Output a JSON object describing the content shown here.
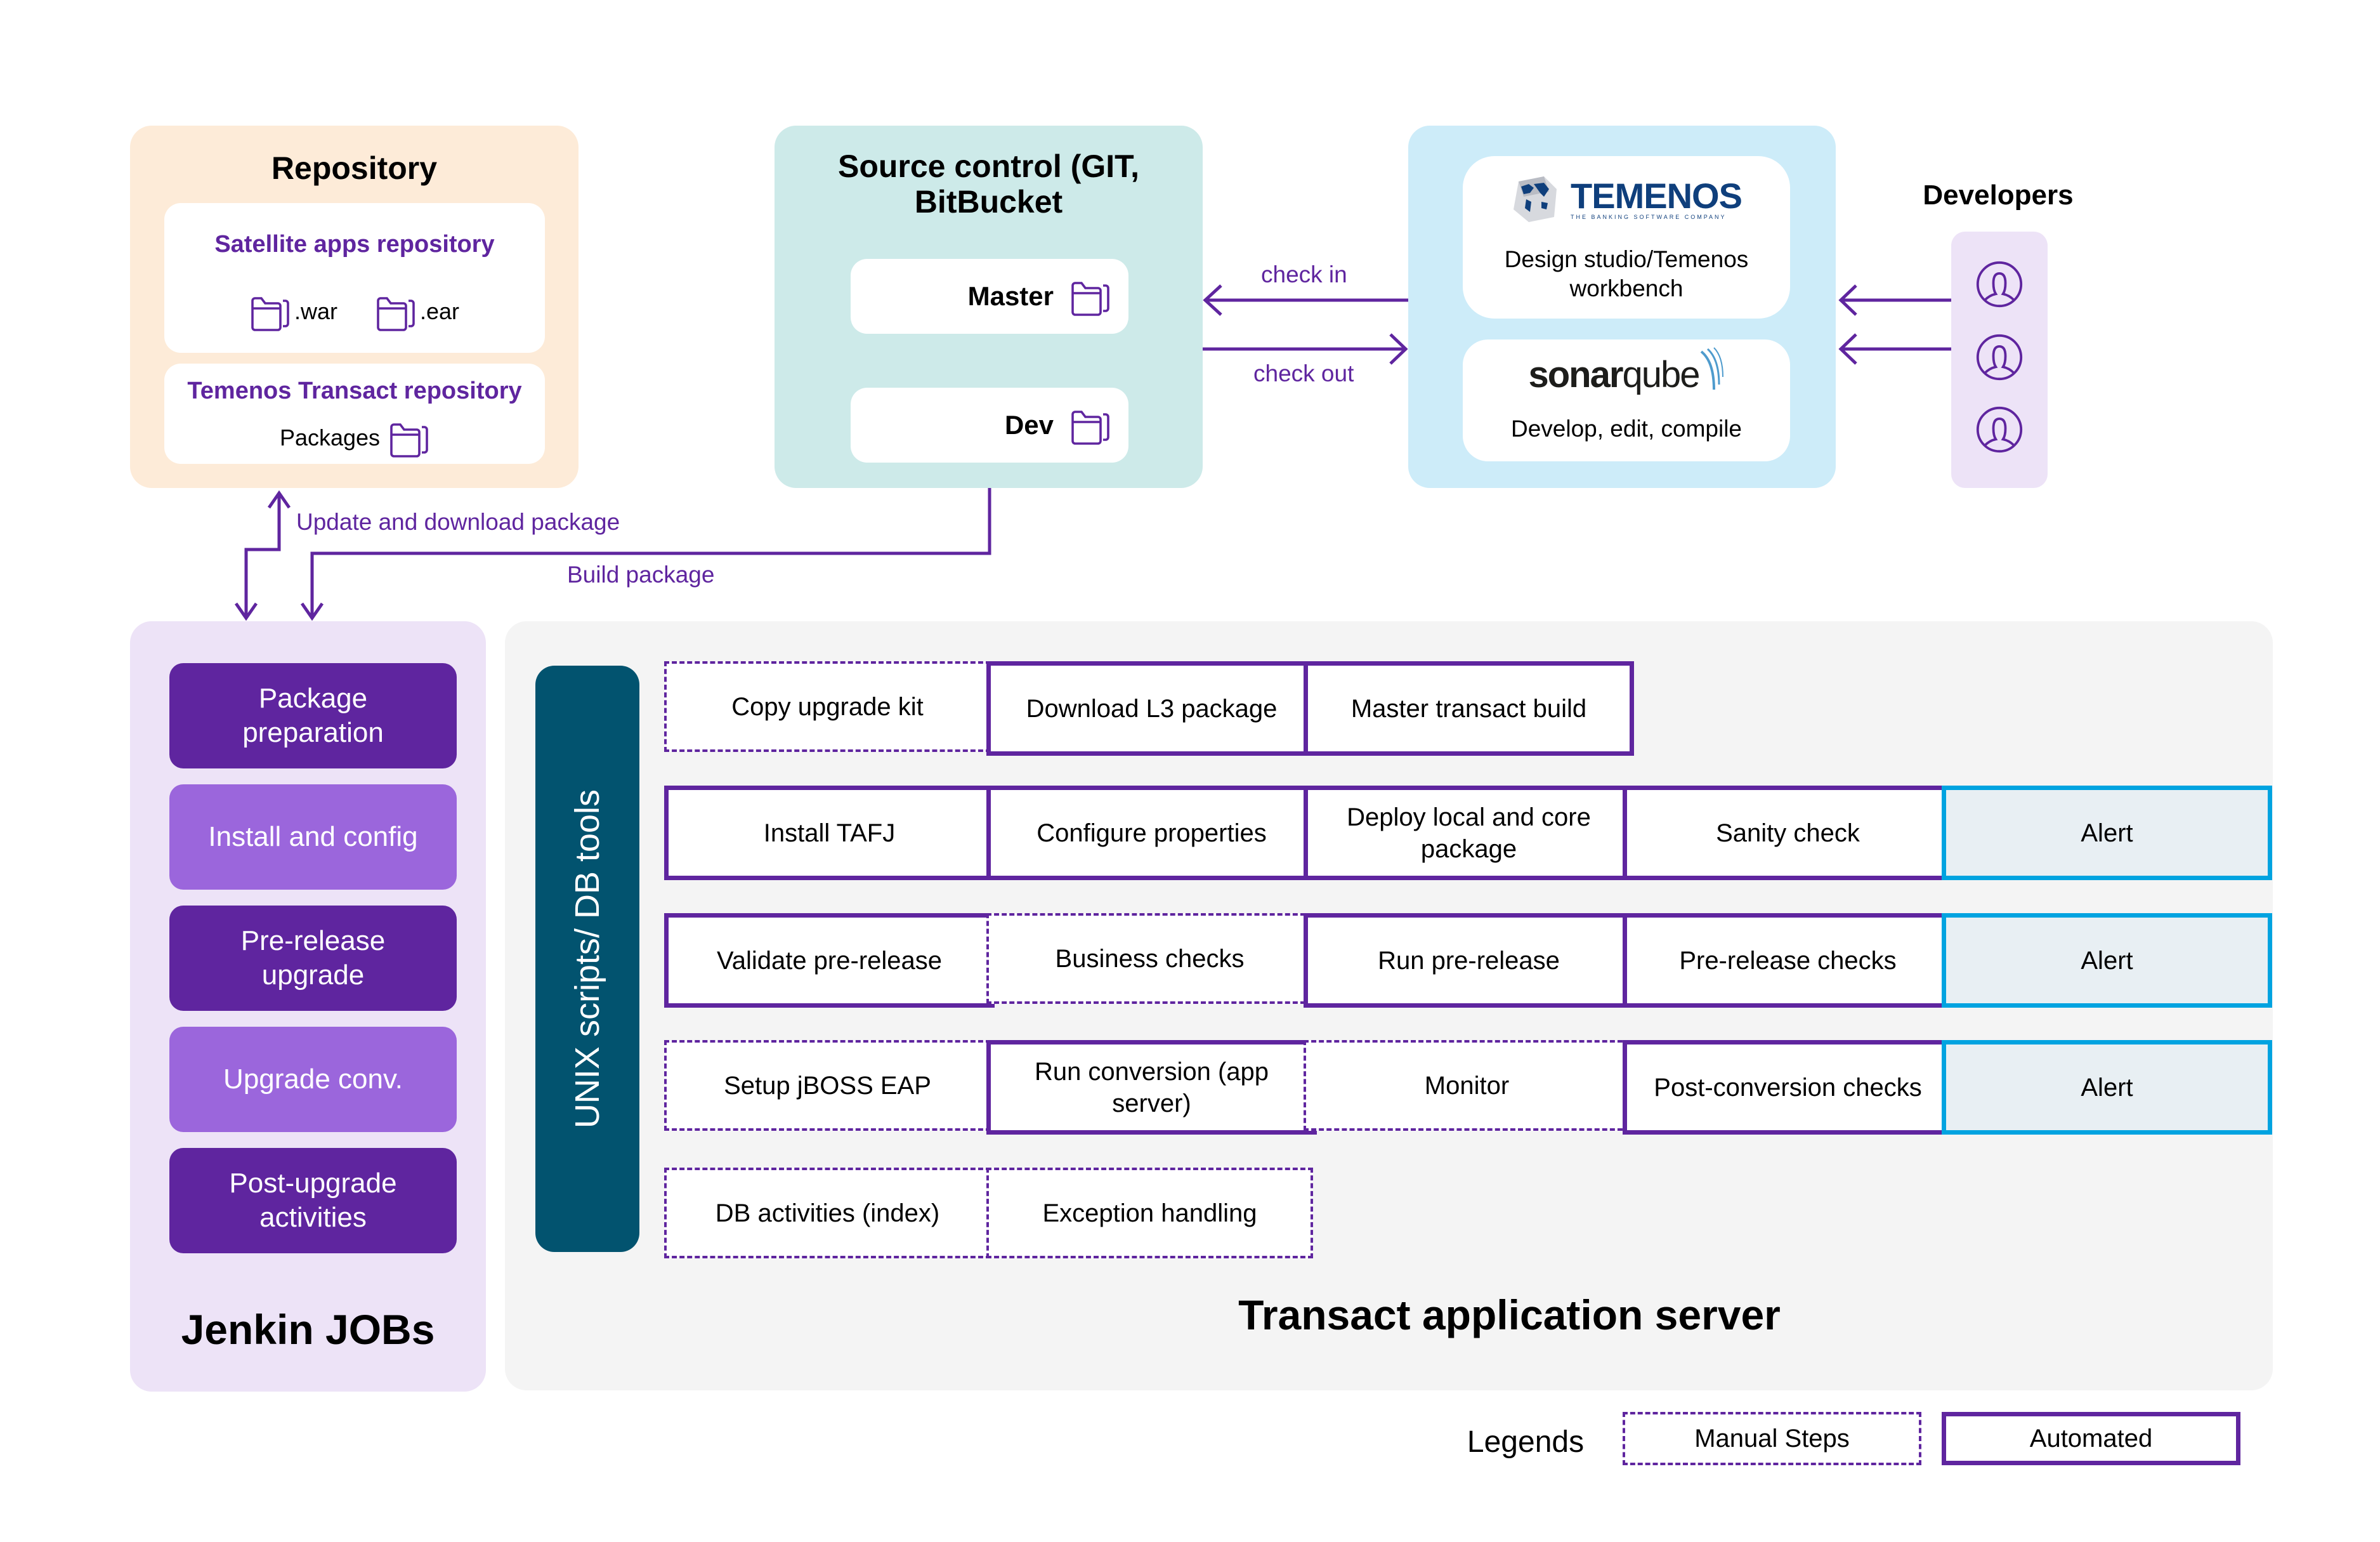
{
  "repository": {
    "title": "Repository",
    "satellite": {
      "title": "Satellite apps repository",
      "files": [
        ".war",
        ".ear"
      ]
    },
    "transact": {
      "title": "Temenos Transact repository",
      "label": "Packages"
    }
  },
  "source_control": {
    "title_line1": "Source control (GIT,",
    "title_line2": "BitBucket",
    "branches": [
      "Master",
      "Dev"
    ]
  },
  "tools": {
    "temenos_logo": "TEMENOS",
    "temenos_tagline": "THE BANKING SOFTWARE COMPANY",
    "temenos_desc_line1": "Design studio/Temenos",
    "temenos_desc_line2": "workbench",
    "sonar_logo_bold": "sonar",
    "sonar_logo_light": "qube",
    "sonar_desc": "Develop, edit, compile"
  },
  "developers": {
    "title": "Developers",
    "count": 3
  },
  "connectors": {
    "check_in": "check in",
    "check_out": "check out",
    "update_download": "Update and download package",
    "build_package": "Build package"
  },
  "jenkins": {
    "title": "Jenkin JOBs",
    "jobs": [
      {
        "line1": "Package",
        "line2": "preparation",
        "shade": "dark"
      },
      {
        "line1": "Install and config",
        "line2": "",
        "shade": "light"
      },
      {
        "line1": "Pre-release",
        "line2": "upgrade",
        "shade": "dark"
      },
      {
        "line1": "Upgrade conv.",
        "line2": "",
        "shade": "light"
      },
      {
        "line1": "Post-upgrade",
        "line2": "activities",
        "shade": "dark"
      }
    ]
  },
  "server": {
    "title": "Transact application server",
    "side_label": "UNIX scripts/ DB tools",
    "rows": [
      [
        {
          "label": "Copy upgrade kit",
          "type": "manual"
        },
        {
          "label": "Download L3 package",
          "type": "auto"
        },
        {
          "label": "Master transact build",
          "type": "auto"
        }
      ],
      [
        {
          "label": "Install TAFJ",
          "type": "auto"
        },
        {
          "label": "Configure properties",
          "type": "auto"
        },
        {
          "label": "Deploy local and core package",
          "type": "auto"
        },
        {
          "label": "Sanity check",
          "type": "auto"
        },
        {
          "label": "Alert",
          "type": "alert"
        }
      ],
      [
        {
          "label": "Validate pre-release",
          "type": "auto"
        },
        {
          "label": "Business checks",
          "type": "manual"
        },
        {
          "label": "Run pre-release",
          "type": "auto"
        },
        {
          "label": "Pre-release checks",
          "type": "auto"
        },
        {
          "label": "Alert",
          "type": "alert"
        }
      ],
      [
        {
          "label": "Setup jBOSS EAP",
          "type": "manual"
        },
        {
          "label": "Run conversion (app server)",
          "type": "auto"
        },
        {
          "label": "Monitor",
          "type": "manual"
        },
        {
          "label": "Post-conversion checks",
          "type": "auto"
        },
        {
          "label": "Alert",
          "type": "alert"
        }
      ],
      [
        {
          "label": "DB activities (index)",
          "type": "manual"
        },
        {
          "label": "Exception handling",
          "type": "manual"
        }
      ]
    ]
  },
  "legend": {
    "title": "Legends",
    "manual": "Manual Steps",
    "automated": "Automated"
  },
  "colors": {
    "purple": "#5f259f",
    "light_purple": "#9b66dc",
    "alert_blue": "#00a3e0",
    "teal": "#02536f"
  }
}
